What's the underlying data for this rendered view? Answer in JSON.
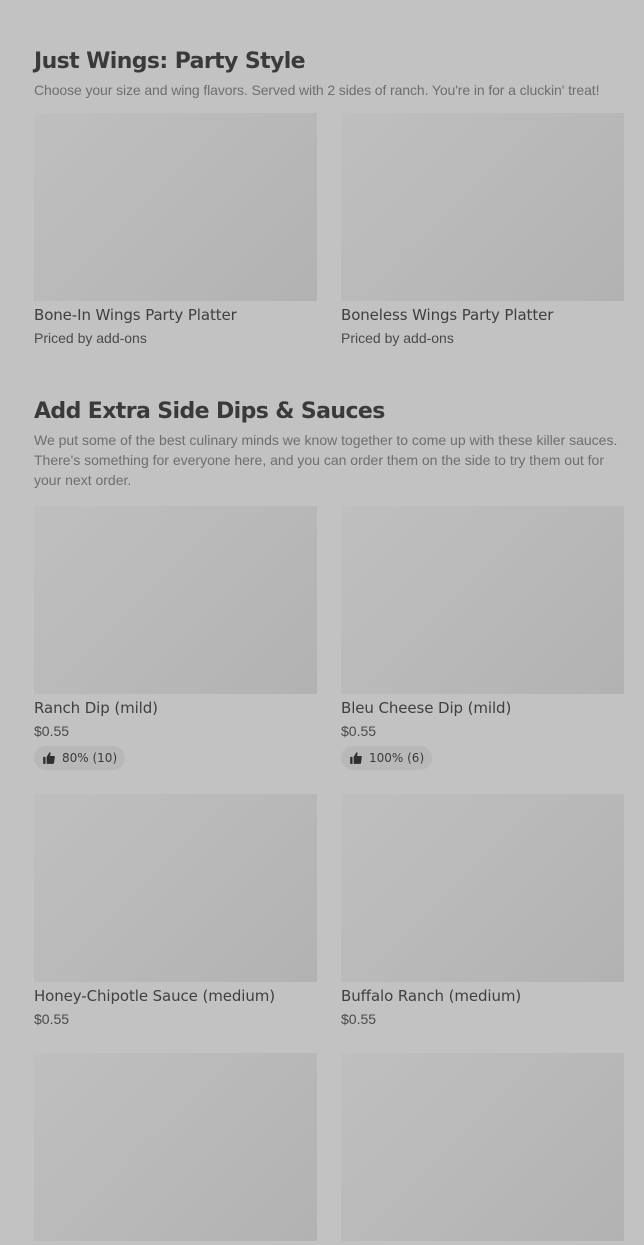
{
  "sections": [
    {
      "title": "Just Wings: Party Style",
      "description": "Choose your size and wing flavors. Served with 2 sides of ranch. You're in for a cluckin' treat!",
      "items": [
        {
          "name": "Bone-In Wings Party Platter",
          "price": "Priced by add-ons"
        },
        {
          "name": "Boneless Wings Party Platter",
          "price": "Priced by add-ons"
        }
      ]
    },
    {
      "title": "Add Extra Side Dips & Sauces",
      "description": "We put some of the best culinary minds we know together to come up with these killer sauces. There's something for everyone here, and you can order them on the side to try them out for your next order.",
      "items": [
        {
          "name": "Ranch Dip (mild)",
          "price": "$0.55",
          "rating": "80% (10)"
        },
        {
          "name": "Bleu Cheese Dip (mild)",
          "price": "$0.55",
          "rating": "100% (6)"
        },
        {
          "name": "Honey-Chipotle Sauce (medium)",
          "price": "$0.55"
        },
        {
          "name": "Buffalo Ranch (medium)",
          "price": "$0.55"
        },
        {
          "name": "",
          "price": ""
        },
        {
          "name": "",
          "price": ""
        }
      ]
    }
  ],
  "icons": {
    "rating": "thumbs-up-icon"
  }
}
